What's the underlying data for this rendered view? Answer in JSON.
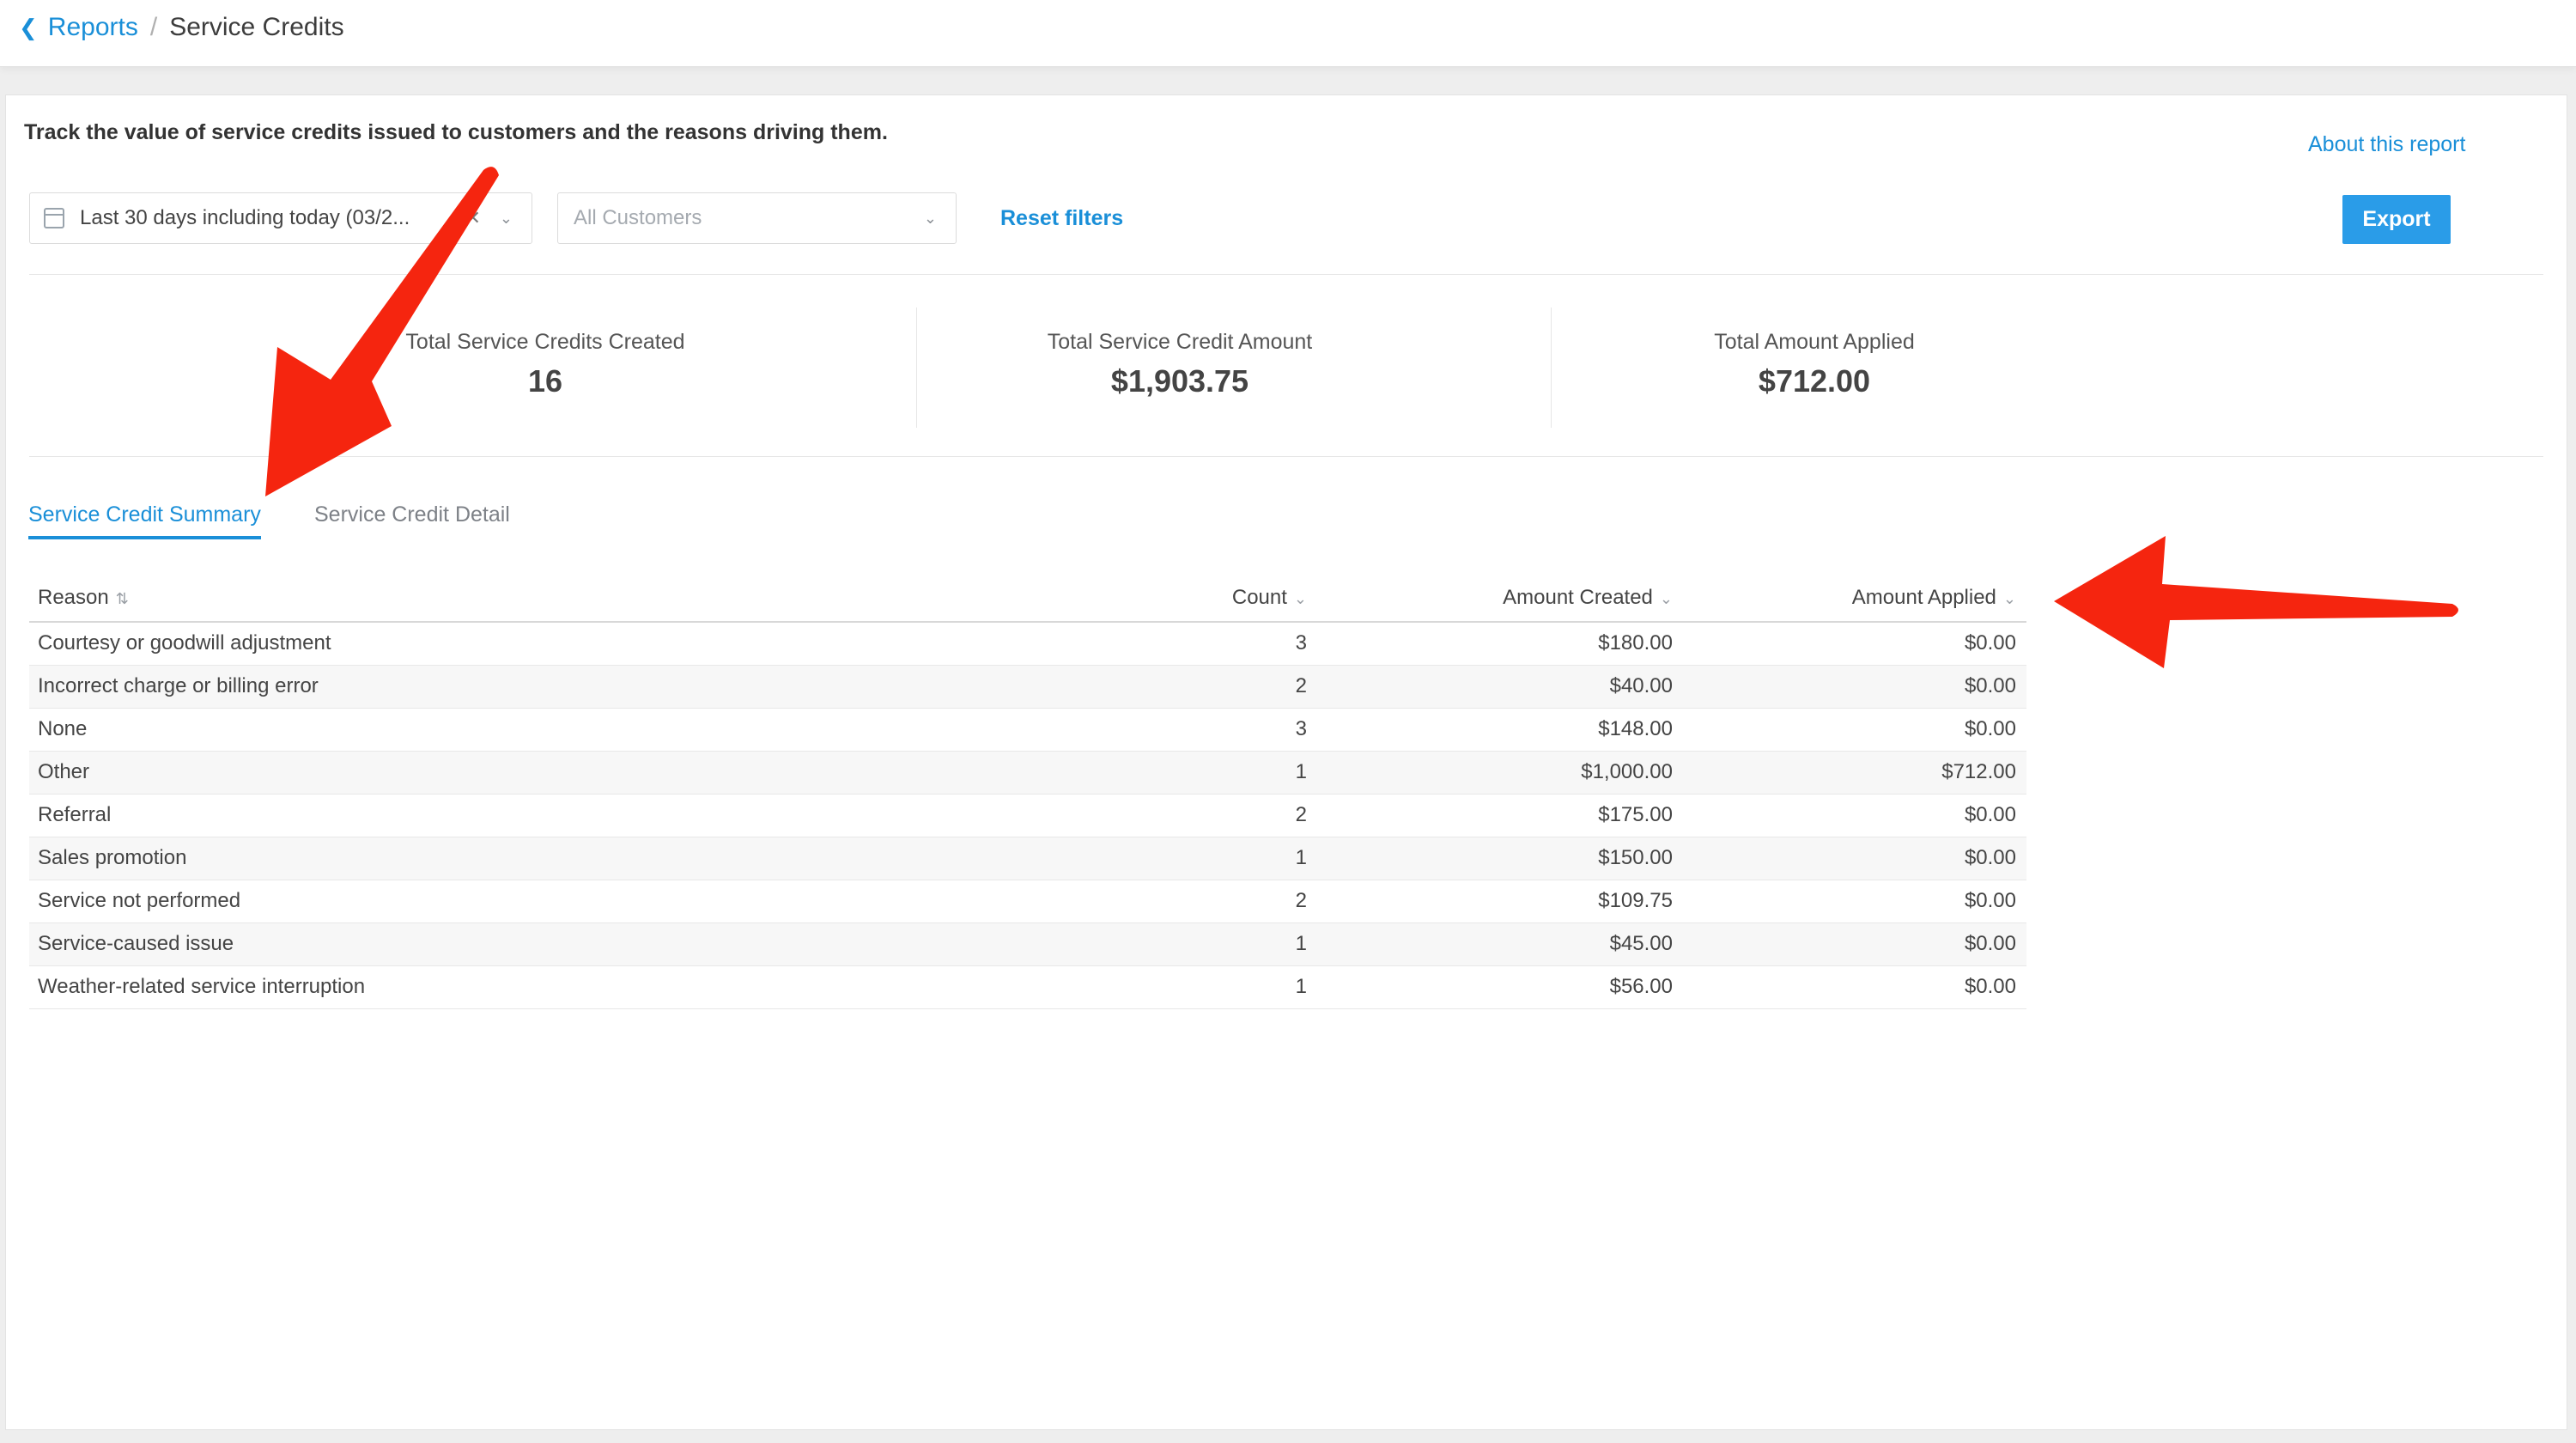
{
  "breadcrumb": {
    "back_icon": "chevron-left-icon",
    "parent": "Reports",
    "separator": "/",
    "current": "Service Credits"
  },
  "description": "Track the value of service credits issued to customers and the reasons driving them.",
  "about_link": "About this report",
  "filters": {
    "date_range": "Last 30 days including today (03/2...",
    "customer_placeholder": "All Customers",
    "reset_label": "Reset filters"
  },
  "export_label": "Export",
  "stats": [
    {
      "label": "Total Service Credits Created",
      "value": "16"
    },
    {
      "label": "Total Service Credit Amount",
      "value": "$1,903.75"
    },
    {
      "label": "Total Amount Applied",
      "value": "$712.00"
    }
  ],
  "tabs": [
    {
      "label": "Service Credit Summary"
    },
    {
      "label": "Service Credit Detail"
    }
  ],
  "table": {
    "headers": {
      "reason": "Reason",
      "count": "Count",
      "amount_created": "Amount Created",
      "amount_applied": "Amount Applied"
    },
    "rows": [
      {
        "reason": "Courtesy or goodwill adjustment",
        "count": "3",
        "amount_created": "$180.00",
        "amount_applied": "$0.00"
      },
      {
        "reason": "Incorrect charge or billing error",
        "count": "2",
        "amount_created": "$40.00",
        "amount_applied": "$0.00"
      },
      {
        "reason": "None",
        "count": "3",
        "amount_created": "$148.00",
        "amount_applied": "$0.00"
      },
      {
        "reason": "Other",
        "count": "1",
        "amount_created": "$1,000.00",
        "amount_applied": "$712.00"
      },
      {
        "reason": "Referral",
        "count": "2",
        "amount_created": "$175.00",
        "amount_applied": "$0.00"
      },
      {
        "reason": "Sales promotion",
        "count": "1",
        "amount_created": "$150.00",
        "amount_applied": "$0.00"
      },
      {
        "reason": "Service not performed",
        "count": "2",
        "amount_created": "$109.75",
        "amount_applied": "$0.00"
      },
      {
        "reason": "Service-caused issue",
        "count": "1",
        "amount_created": "$45.00",
        "amount_applied": "$0.00"
      },
      {
        "reason": "Weather-related service interruption",
        "count": "1",
        "amount_created": "$56.00",
        "amount_applied": "$0.00"
      }
    ]
  },
  "colors": {
    "accent": "#1a8fd8",
    "export_button": "#2a9ce8",
    "annotation_arrow": "#f5250f"
  }
}
